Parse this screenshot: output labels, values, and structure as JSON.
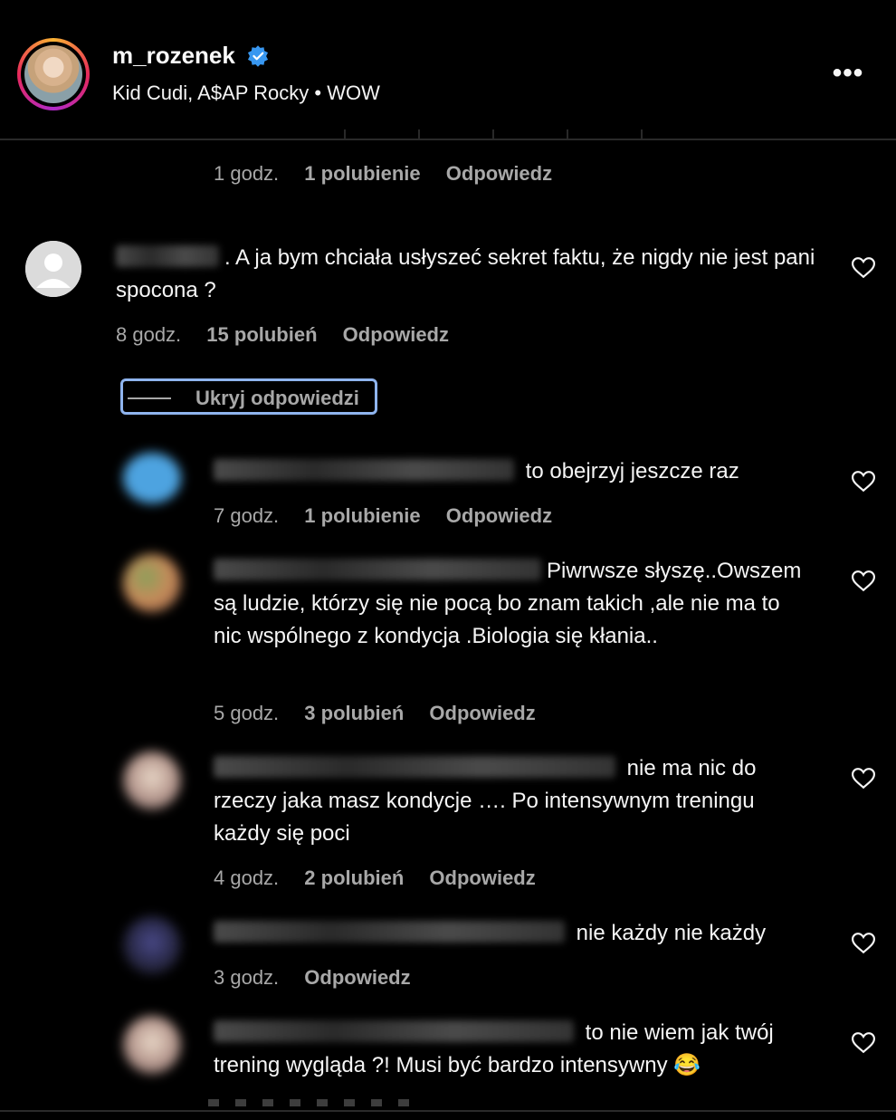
{
  "header": {
    "username": "m_rozenek",
    "audio": "Kid Cudi, A$AP Rocky • WOW",
    "more_label": "•••"
  },
  "colors": {
    "verified": "#3897f0",
    "ring_start": "#f9b233",
    "ring_end": "#b02ac9",
    "focus": "#8fb4ee"
  },
  "comments": [
    {
      "time": "1 godz.",
      "likes": "1 polubienie",
      "reply": "Odpowiedz"
    },
    {
      "text": ". A ja bym chciała usłyszeć sekret faktu, że nigdy nie jest pani spocona ?",
      "time": "8 godz.",
      "likes": "15 polubień",
      "reply": "Odpowiedz",
      "heart_icon": "heart-outline-icon"
    }
  ],
  "hide_replies": "Ukryj odpowiedzi",
  "replies": [
    {
      "text": " to obejrzyj jeszcze raz",
      "time": "7 godz.",
      "likes": "1 polubienie",
      "reply": "Odpowiedz"
    },
    {
      "text": "Piwrwsze słyszę..Owszem są ludzie, którzy się nie pocą bo znam takich ,ale nie ma to nic wspólnego z kondycja .Biologia się kłania..",
      "time": "5 godz.",
      "likes": "3 polubień",
      "reply": "Odpowiedz"
    },
    {
      "text": " nie ma nic do rzeczy jaka masz kondycje …. Po intensywnym treningu każdy się poci",
      "time": "4 godz.",
      "likes": "2 polubień",
      "reply": "Odpowiedz"
    },
    {
      "text": " nie każdy nie każdy",
      "time": "3 godz.",
      "reply": "Odpowiedz"
    },
    {
      "text": " to nie wiem jak twój trening wygląda ?! Musi być bardzo intensywny 😂"
    }
  ]
}
